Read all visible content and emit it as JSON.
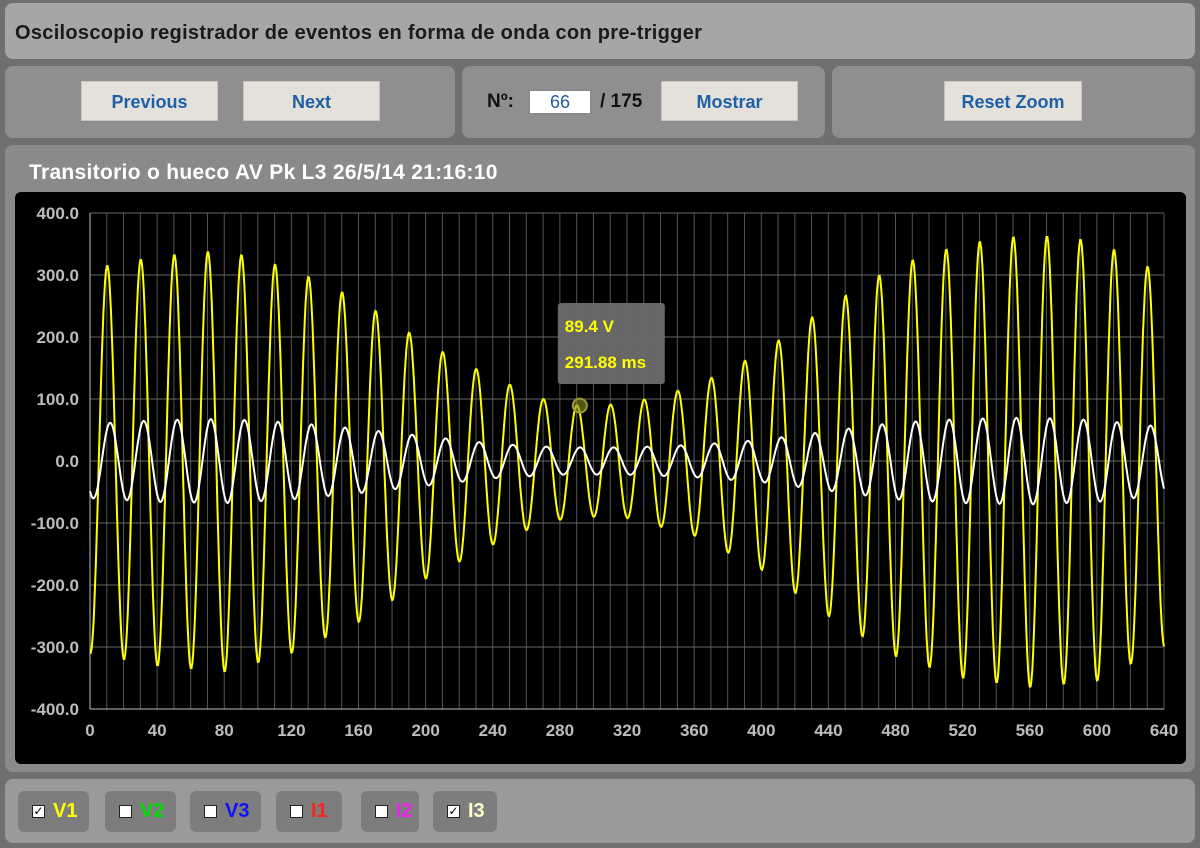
{
  "app_title": "Osciloscopio registrador de eventos en forma de onda con pre-trigger",
  "nav": {
    "previous_label": "Previous",
    "next_label": "Next"
  },
  "event_selector": {
    "label": "Nº:",
    "value": "66",
    "total": "/ 175",
    "show_label": "Mostrar"
  },
  "zoom": {
    "reset_label": "Reset Zoom"
  },
  "chart_title": "Transitorio o hueco AV Pk L3 26/5/14 21:16:10",
  "tooltip": {
    "value": "89.4 V",
    "time": "291.88 ms"
  },
  "channels": [
    {
      "name": "V1",
      "checked": true,
      "color": "#ffff00"
    },
    {
      "name": "V2",
      "checked": false,
      "color": "#00dd00"
    },
    {
      "name": "V3",
      "checked": false,
      "color": "#1010ff"
    },
    {
      "name": "I1",
      "checked": false,
      "color": "#ff2020"
    },
    {
      "name": "I2",
      "checked": false,
      "color": "#ee22ee"
    },
    {
      "name": "I3",
      "checked": true,
      "color": "#ffffcc"
    }
  ],
  "chart_data": {
    "type": "line",
    "title": "Transitorio o hueco AV Pk L3 26/5/14 21:16:10",
    "xlabel": "",
    "ylabel": "",
    "xlim": [
      0,
      640
    ],
    "ylim": [
      -400,
      400
    ],
    "x_ticks": [
      "0",
      "40",
      "80",
      "120",
      "160",
      "200",
      "240",
      "280",
      "320",
      "360",
      "400",
      "440",
      "480",
      "520",
      "560",
      "600",
      "640"
    ],
    "y_ticks": [
      "400.0",
      "300.0",
      "200.0",
      "100.0",
      "0.0",
      "-100.0",
      "-200.0",
      "-300.0",
      "-400.0"
    ],
    "grid": true,
    "frequency_hz": 50,
    "series": [
      {
        "name": "V1",
        "color": "#ffff00",
        "envelope_time_ms": [
          0,
          40,
          80,
          120,
          160,
          200,
          240,
          270,
          292,
          320,
          360,
          400,
          440,
          480,
          520,
          560,
          600,
          640
        ],
        "envelope_peak_v": [
          310,
          330,
          340,
          310,
          260,
          190,
          135,
          100,
          89,
          92,
          120,
          175,
          250,
          315,
          350,
          365,
          355,
          300
        ]
      },
      {
        "name": "I3",
        "color": "#ffffff",
        "envelope_time_ms": [
          0,
          40,
          80,
          120,
          160,
          200,
          240,
          280,
          320,
          360,
          400,
          440,
          480,
          520,
          560,
          600,
          640
        ],
        "envelope_peak_v": [
          60,
          66,
          68,
          62,
          52,
          40,
          28,
          22,
          22,
          26,
          34,
          48,
          62,
          68,
          70,
          66,
          55
        ]
      }
    ],
    "highlight_point": {
      "x": 291.88,
      "y": 89.4
    }
  }
}
